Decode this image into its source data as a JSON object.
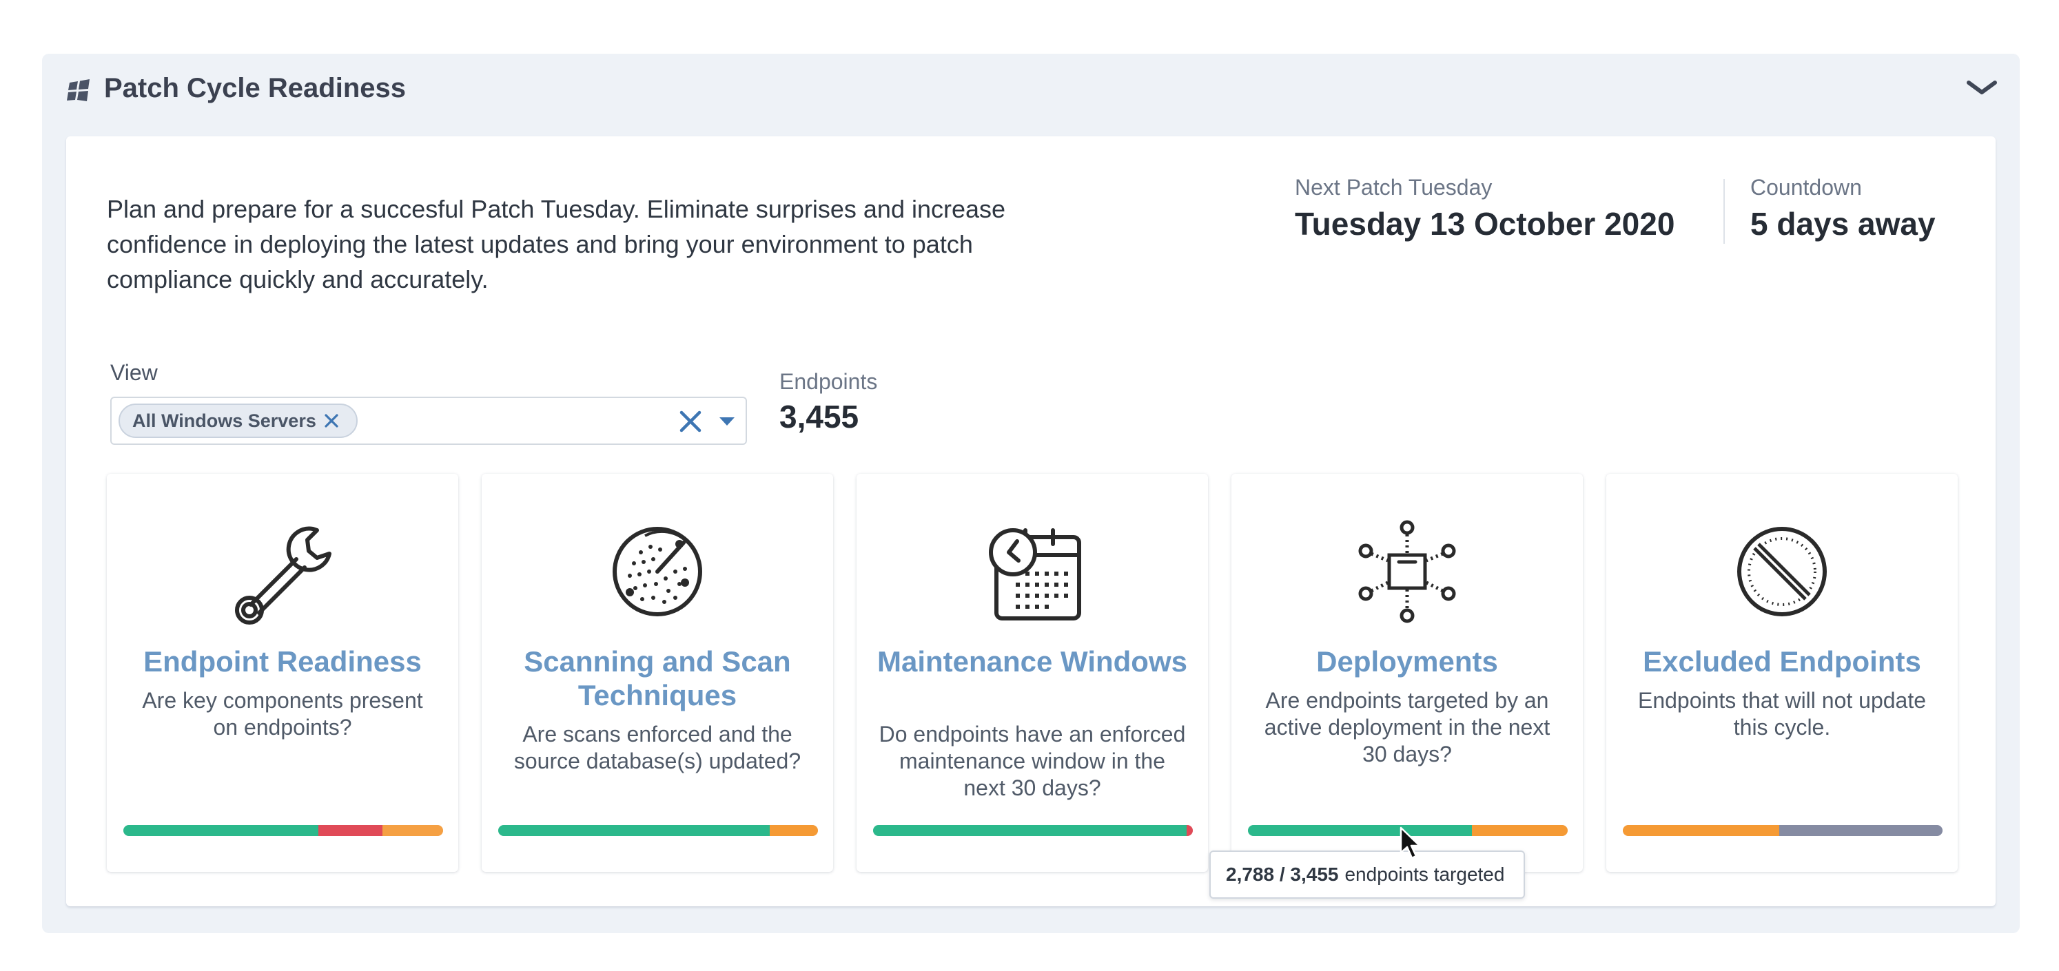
{
  "panel": {
    "title": "Patch Cycle Readiness",
    "icon": "windows-icon",
    "collapse_icon": "chevron-down-icon"
  },
  "intro": "Plan and prepare for a succesful Patch Tuesday. Eliminate surprises and increase confidence in deploying the latest updates and bring your environment to patch compliance quickly and accurately.",
  "next_patch": {
    "label": "Next Patch Tuesday",
    "value": "Tuesday 13 October 2020"
  },
  "countdown": {
    "label": "Countdown",
    "value": "5 days away"
  },
  "view": {
    "label": "View",
    "selected": "All Windows Servers",
    "clear_icon": "close-icon",
    "dropdown_icon": "caret-down-icon"
  },
  "endpoints": {
    "label": "Endpoints",
    "value": "3,455"
  },
  "colors": {
    "green": "#2bb88b",
    "red": "#e04a57",
    "orange": "#f59a34",
    "gray": "#858ba2",
    "title_blue": "#6a97c4"
  },
  "tiles": [
    {
      "icon": "wrench-icon",
      "title": "Endpoint Readiness",
      "description": "Are key components present on endpoints?",
      "bar": [
        {
          "color": "#2bb88b",
          "fraction": 0.61
        },
        {
          "color": "#e04a57",
          "fraction": 0.2
        },
        {
          "color": "#f5a043",
          "fraction": 0.19
        }
      ]
    },
    {
      "icon": "radar-icon",
      "title": "Scanning and Scan Techniques",
      "description": "Are scans enforced and the source database(s) updated?",
      "bar": [
        {
          "color": "#2bb88b",
          "fraction": 0.85
        },
        {
          "color": "#f59a34",
          "fraction": 0.15
        }
      ]
    },
    {
      "icon": "calendar-clock-icon",
      "title": "Maintenance Windows",
      "description": "Do endpoints have an enforced maintenance window in the next 30 days?",
      "bar": [
        {
          "color": "#2bb88b",
          "fraction": 0.98
        },
        {
          "color": "#e04a57",
          "fraction": 0.02
        }
      ]
    },
    {
      "icon": "deployment-network-icon",
      "title": "Deployments",
      "description": "Are endpoints targeted by an active deployment in the next 30 days?",
      "bar": [
        {
          "color": "#2bb88b",
          "fraction": 0.7
        },
        {
          "color": "#f59a34",
          "fraction": 0.3
        }
      ]
    },
    {
      "icon": "prohibited-icon",
      "title": "Excluded Endpoints",
      "description": "Endpoints that will not update this cycle.",
      "bar": [
        {
          "color": "#f59a34",
          "fraction": 0.49
        },
        {
          "color": "#858ba2",
          "fraction": 0.51
        }
      ]
    }
  ],
  "tooltip": {
    "count": "2,788 / 3,455",
    "text": "endpoints targeted"
  }
}
